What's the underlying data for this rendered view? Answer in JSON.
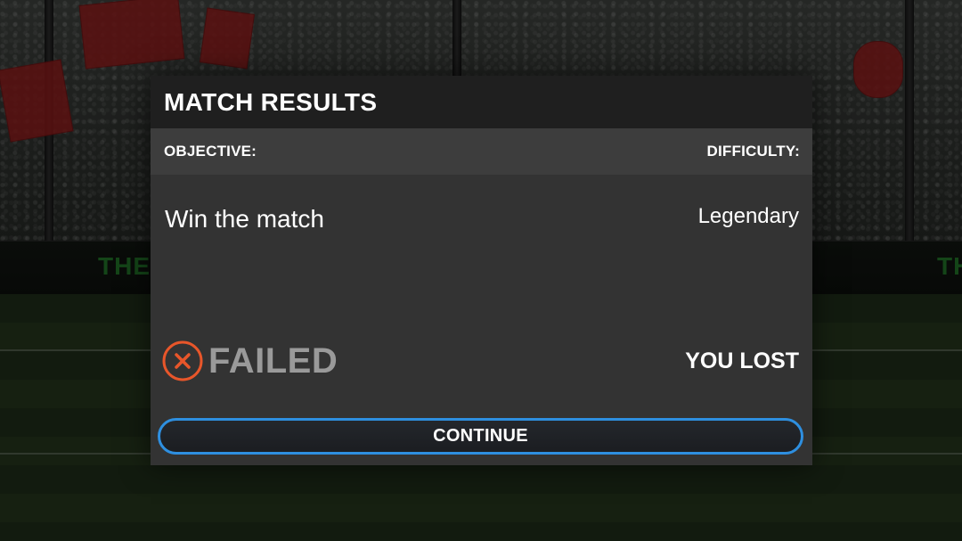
{
  "dialog": {
    "title": "MATCH RESULTS",
    "objective_label": "OBJECTIVE:",
    "difficulty_label": "DIFFICULTY:",
    "objective_value": "Win the match",
    "difficulty_value": "Legendary",
    "status": "FAILED",
    "outcome": "YOU LOST",
    "continue_label": "CONTINUE"
  },
  "icons": {
    "status_icon": "close-circle-icon"
  },
  "colors": {
    "fail_accent": "#e8562a",
    "button_border": "#2e8fe0",
    "status_text": "#9a9a9a"
  }
}
